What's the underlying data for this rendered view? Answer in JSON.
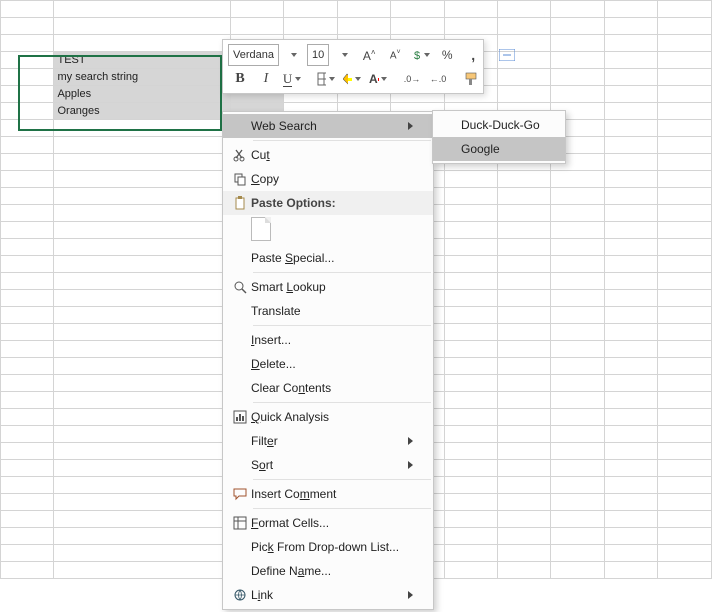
{
  "cells": {
    "b4": "TEST",
    "b5": "my search string",
    "b6": "Apples",
    "b7": "Oranges"
  },
  "miniToolbar": {
    "fontName": "Verdana",
    "fontSize": "10"
  },
  "contextMenu": {
    "webSearch": "Web Search",
    "cut": "Cut",
    "copy": "Copy",
    "pasteOptions": "Paste Options:",
    "pasteSpecial": "Paste Special...",
    "smartLookup": "Smart Lookup",
    "translate": "Translate",
    "insert": "Insert...",
    "delete": "Delete...",
    "clearContents": "Clear Contents",
    "quickAnalysis": "Quick Analysis",
    "filter": "Filter",
    "sort": "Sort",
    "insertComment": "Insert Comment",
    "formatCells": "Format Cells...",
    "pickFromList": "Pick From Drop-down List...",
    "defineName": "Define Name...",
    "link": "Link"
  },
  "subMenu": {
    "duckDuckGo": "Duck-Duck-Go",
    "google": "Google"
  }
}
